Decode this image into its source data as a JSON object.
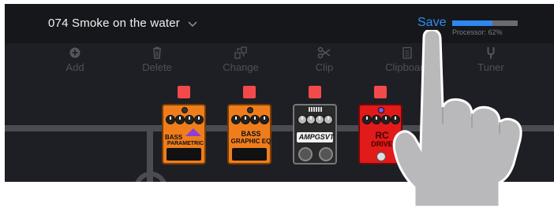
{
  "header": {
    "preset_name": "074 Smoke on the water",
    "save_label": "Save",
    "processor_label": "Processor: 62%",
    "processor_load": 0.62
  },
  "toolbar": {
    "items": [
      {
        "label": "Add",
        "icon": "plus-circle-icon"
      },
      {
        "label": "Delete",
        "icon": "trash-icon"
      },
      {
        "label": "Change",
        "icon": "swap-icon"
      },
      {
        "label": "Clip",
        "icon": "scissors-icon"
      },
      {
        "label": "Clipboard",
        "icon": "clipboard-icon"
      },
      {
        "label": "Tuner",
        "icon": "tuning-fork-icon"
      }
    ]
  },
  "pedals": [
    {
      "label_line1": "BASS",
      "label_line2": "PARAMETRIC EQ",
      "color": "#f07d1c"
    },
    {
      "label_line1": "BASS",
      "label_line2": "GRAPHIC EQ",
      "color": "#f07d1c"
    },
    {
      "label_line1": "AMPGSVT",
      "label_line2": "",
      "color": "#2a2a2a"
    },
    {
      "label_line1": "RC",
      "label_line2": "DRIVE",
      "color": "#e11a1a"
    }
  ],
  "colors": {
    "accent": "#2f8cf5",
    "select_button": "#f24a4a",
    "background": "#1e1f24"
  }
}
